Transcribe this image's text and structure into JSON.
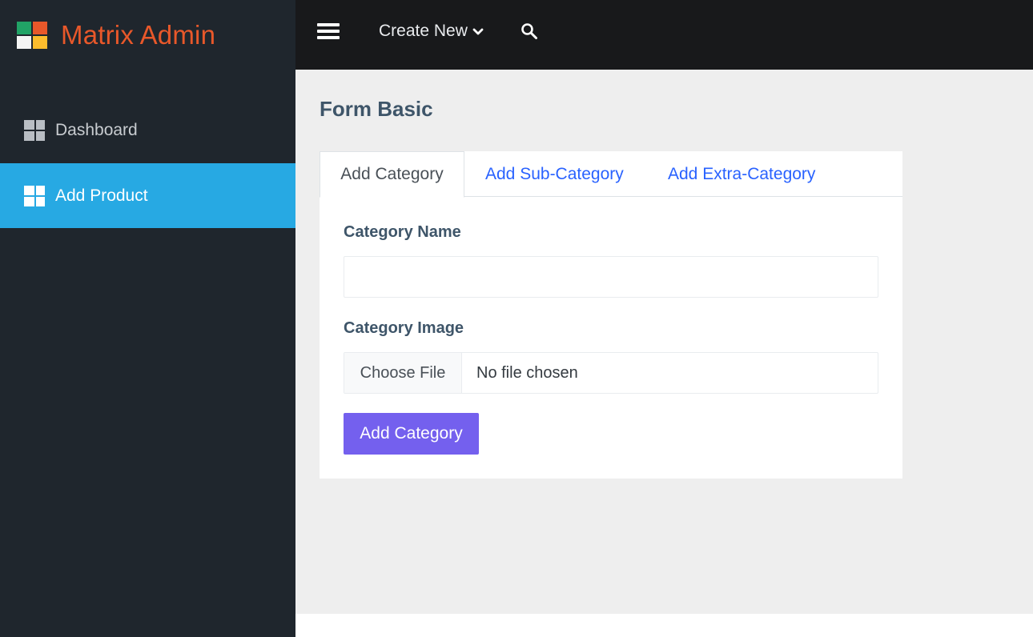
{
  "brand": {
    "name": "Matrix Admin",
    "logo_colors": [
      "#21a366",
      "#e8582a",
      "#f4f4f4",
      "#fcbc2d"
    ],
    "text_color": "#e8582a"
  },
  "sidebar": {
    "items": [
      {
        "label": "Dashboard",
        "icon": "dashboard-icon",
        "active": false
      },
      {
        "label": "Add Product",
        "icon": "dashboard-icon",
        "active": true
      }
    ],
    "active_color": "#27a9e3"
  },
  "topbar": {
    "menu_icon": "hamburger-icon",
    "create_new_label": "Create New",
    "create_new_icon": "chevron-down-icon",
    "search_icon": "search-icon"
  },
  "page": {
    "title": "Form Basic"
  },
  "tabs": [
    {
      "label": "Add Category",
      "active": true
    },
    {
      "label": "Add Sub-Category",
      "active": false
    },
    {
      "label": "Add Extra-Category",
      "active": false
    }
  ],
  "form": {
    "name_label": "Category Name",
    "name_value": "",
    "image_label": "Category Image",
    "file_button_label": "Choose File",
    "file_status": "No file chosen",
    "submit_label": "Add Category",
    "submit_color": "#7460ee"
  }
}
